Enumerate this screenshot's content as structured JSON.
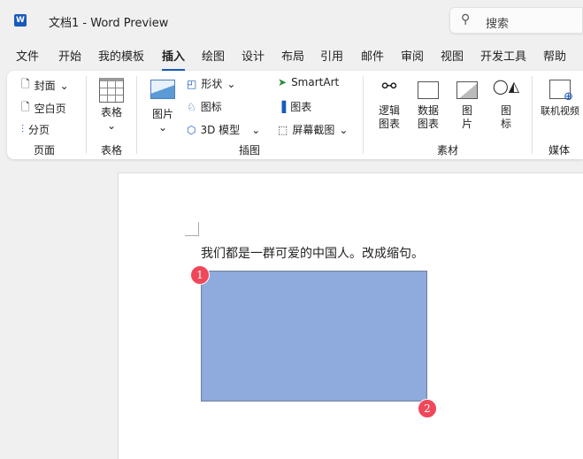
{
  "titlebar": {
    "app_icon": "word-icon",
    "title": "文档1  -  Word Preview",
    "search_placeholder": "搜索"
  },
  "tabs": [
    "文件",
    "开始",
    "我的模板",
    "插入",
    "绘图",
    "设计",
    "布局",
    "引用",
    "邮件",
    "审阅",
    "视图",
    "开发工具",
    "帮助"
  ],
  "active_tab": "插入",
  "ribbon": {
    "pages": {
      "label": "页面",
      "cover": "封面",
      "blank": "空白页",
      "break": "分页"
    },
    "table": {
      "label": "表格",
      "table": "表格"
    },
    "illustrations": {
      "label": "插图",
      "picture": "图片",
      "shapes": "形状",
      "icons": "图标",
      "model3d": "3D 模型",
      "smartart": "SmartArt",
      "chart": "图表",
      "screenshot": "屏幕截图"
    },
    "assets": {
      "label": "素材",
      "logic": "逻辑\n图表",
      "data": "数据\n图表",
      "pic": "图\n片",
      "icon": "图\n标"
    },
    "media": {
      "label": "媒体",
      "video": "联机视频"
    }
  },
  "document": {
    "text": "我们都是一群可爱的中国人。改成缩句。",
    "shape_fill": "#8faadc"
  },
  "annotations": [
    "1",
    "2"
  ]
}
